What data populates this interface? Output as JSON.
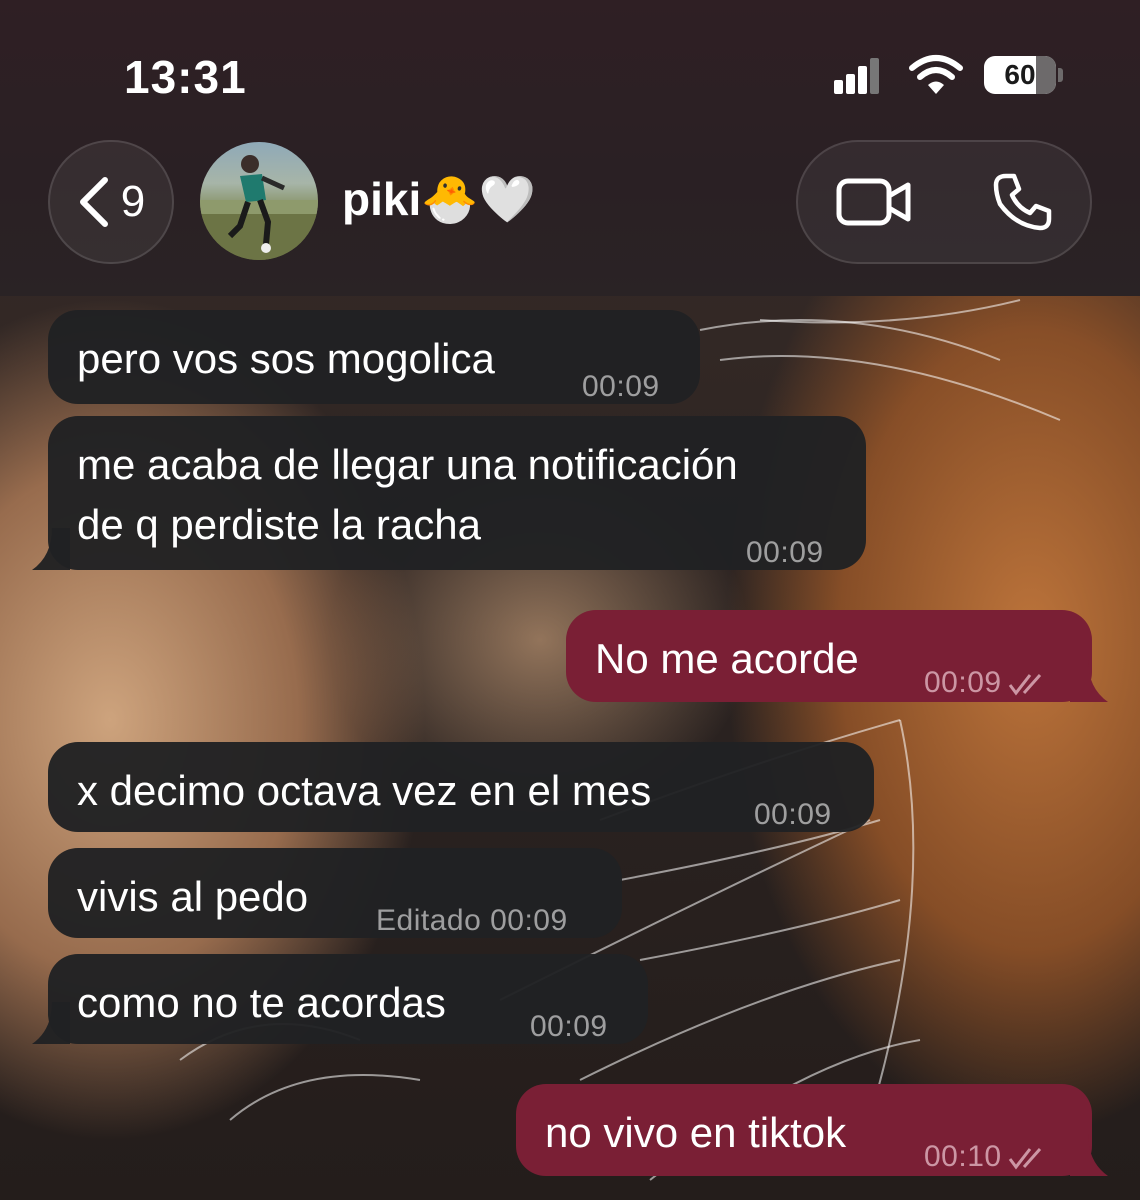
{
  "status_bar": {
    "time": "13:31",
    "battery": "60"
  },
  "header": {
    "back_count": "9",
    "contact_name": "piki🐣🤍"
  },
  "messages": [
    {
      "direction": "in",
      "text": "pero vos sos mogolica",
      "time": "00:09"
    },
    {
      "direction": "in",
      "text_line1": "me acaba de llegar una notificación",
      "text_line2": "de q perdiste la racha",
      "time": "00:09"
    },
    {
      "direction": "out",
      "text": "No me acorde",
      "time": "00:09"
    },
    {
      "direction": "in",
      "text": "x decimo octava vez en el mes",
      "time": "00:09"
    },
    {
      "direction": "in",
      "text": "vivis al pedo",
      "time": "Editado 00:09"
    },
    {
      "direction": "in",
      "text": "como no te acordas",
      "time": "00:09"
    },
    {
      "direction": "out",
      "text": "no vivo en tiktok",
      "time": "00:10"
    }
  ],
  "colors": {
    "incoming_bubble": "#202123",
    "outgoing_bubble": "#7a1f35",
    "header_background": "#2a2024"
  },
  "icons": {
    "back": "chevron-left-icon",
    "video": "video-call-icon",
    "phone": "phone-call-icon",
    "read_receipt": "double-check-icon"
  }
}
